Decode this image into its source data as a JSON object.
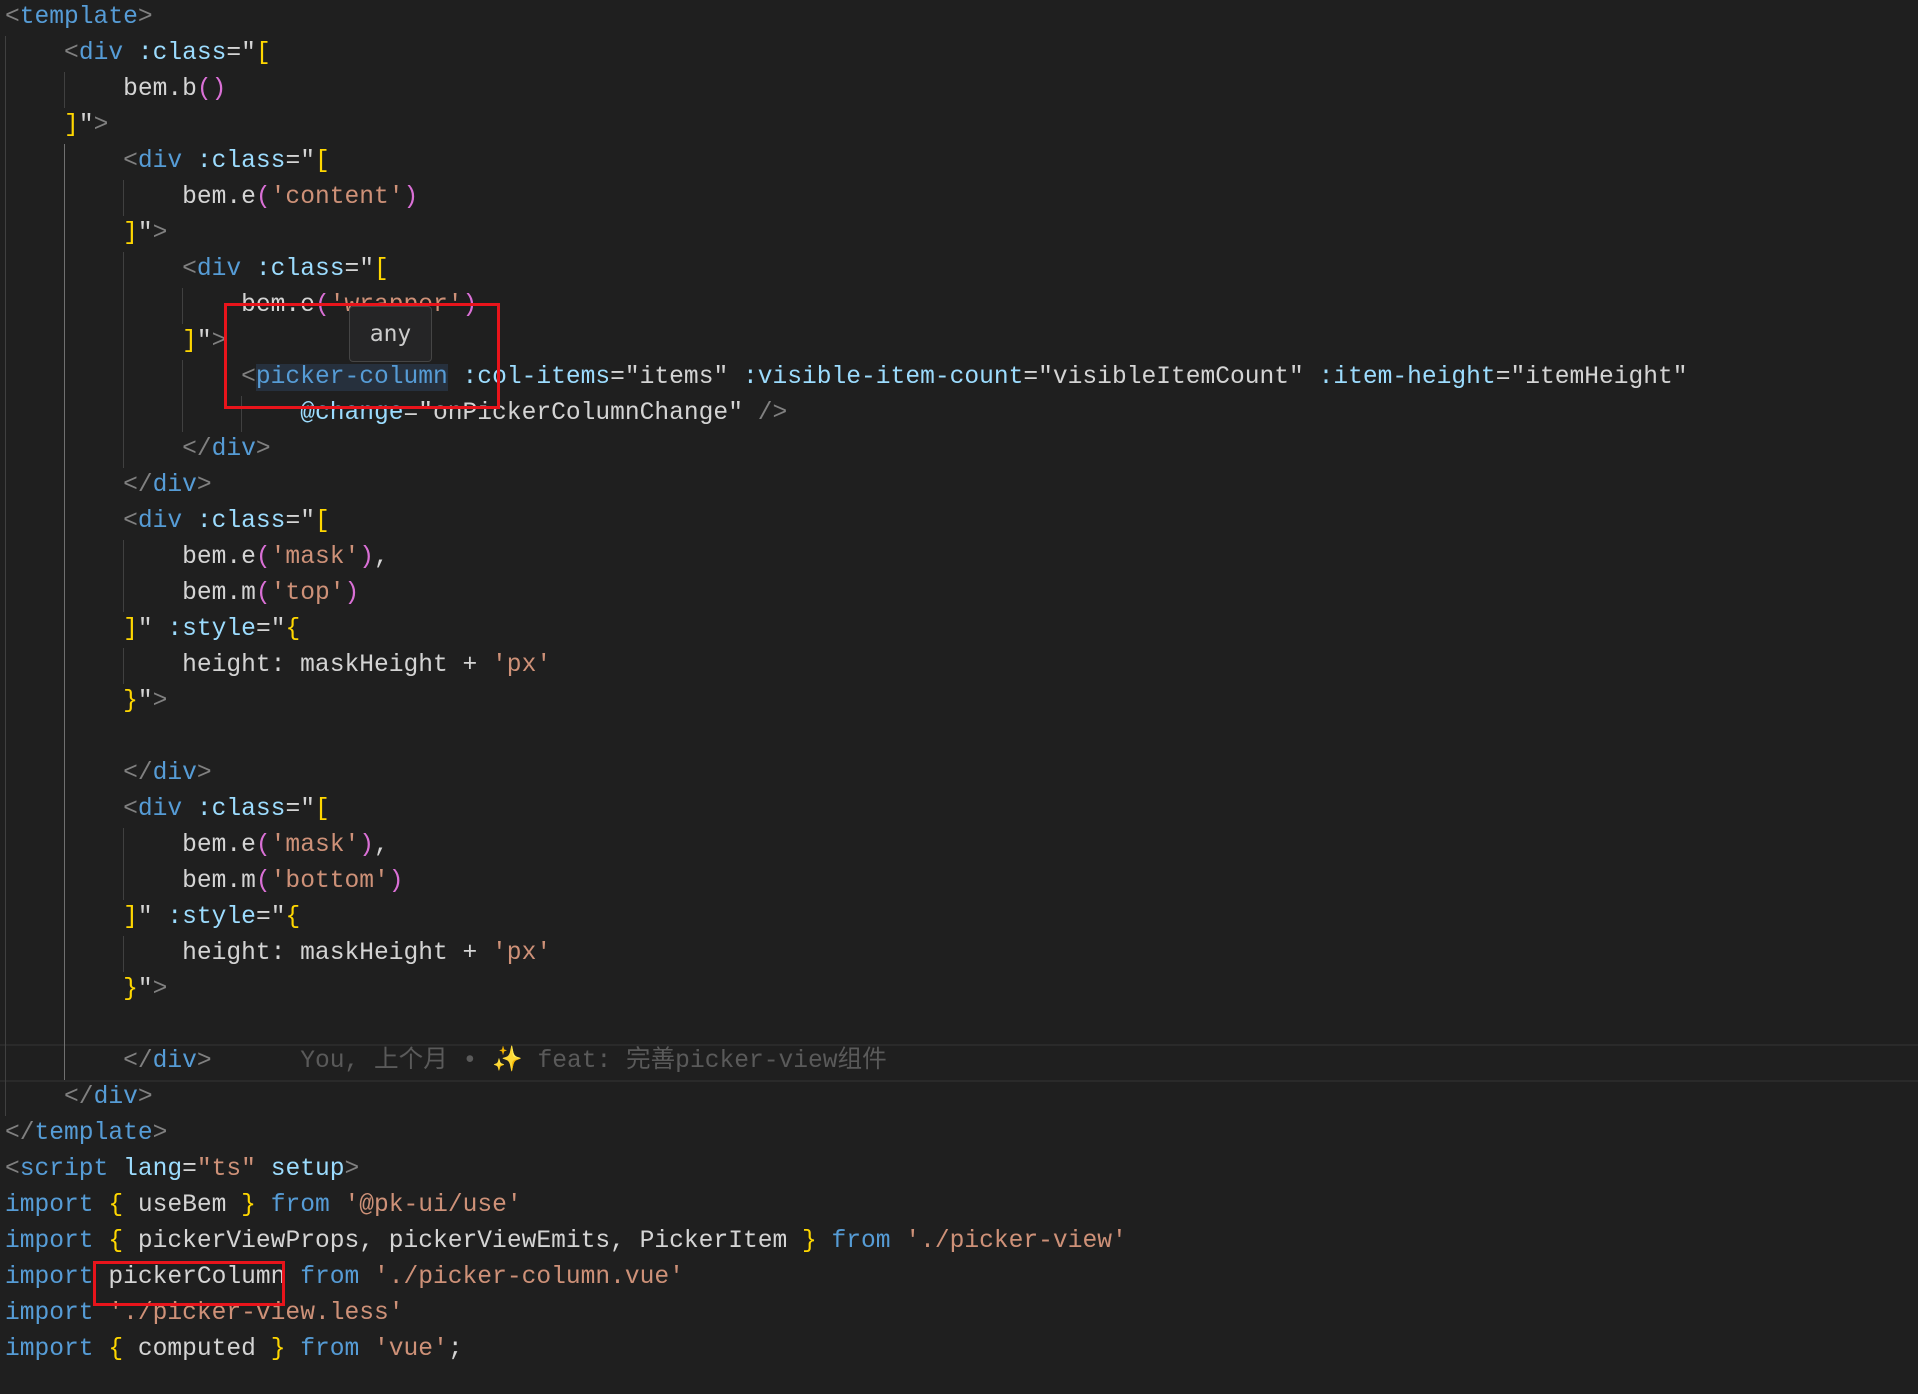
{
  "editor": {
    "language": "vue",
    "lines": [
      [
        [
          "p",
          "<"
        ],
        [
          "t",
          "template"
        ],
        [
          "p",
          ">"
        ]
      ],
      [
        [
          "w",
          "    "
        ],
        [
          "p",
          "<"
        ],
        [
          "t",
          "div"
        ],
        [
          "w",
          " "
        ],
        [
          "a",
          ":class"
        ],
        [
          "w",
          "=\""
        ],
        [
          "y",
          "["
        ]
      ],
      [
        [
          "w",
          "        bem.b"
        ],
        [
          "m",
          "()"
        ]
      ],
      [
        [
          "w",
          "    "
        ],
        [
          "y",
          "]"
        ],
        [
          "w",
          "\""
        ],
        [
          "p",
          ">"
        ]
      ],
      [
        [
          "w",
          "        "
        ],
        [
          "p",
          "<"
        ],
        [
          "t",
          "div"
        ],
        [
          "w",
          " "
        ],
        [
          "a",
          ":class"
        ],
        [
          "w",
          "=\""
        ],
        [
          "y",
          "["
        ]
      ],
      [
        [
          "w",
          "            bem.e"
        ],
        [
          "m",
          "("
        ],
        [
          "s",
          "'content'"
        ],
        [
          "m",
          ")"
        ]
      ],
      [
        [
          "w",
          "        "
        ],
        [
          "y",
          "]"
        ],
        [
          "w",
          "\""
        ],
        [
          "p",
          ">"
        ]
      ],
      [
        [
          "w",
          "            "
        ],
        [
          "p",
          "<"
        ],
        [
          "t",
          "div"
        ],
        [
          "w",
          " "
        ],
        [
          "a",
          ":class"
        ],
        [
          "w",
          "=\""
        ],
        [
          "y",
          "["
        ]
      ],
      [
        [
          "w",
          "                bem.e"
        ],
        [
          "m",
          "("
        ],
        [
          "s",
          "'wrapper'"
        ],
        [
          "m",
          ")"
        ]
      ],
      [
        [
          "w",
          "            "
        ],
        [
          "y",
          "]"
        ],
        [
          "w",
          "\""
        ],
        [
          "p",
          ">"
        ]
      ],
      [
        [
          "w",
          "                "
        ],
        [
          "p",
          "<"
        ],
        [
          "t sel",
          "picker-column"
        ],
        [
          "w",
          " "
        ],
        [
          "a",
          ":col-items"
        ],
        [
          "w",
          "=\"items\" "
        ],
        [
          "a",
          ":visible-item-count"
        ],
        [
          "w",
          "=\"visibleItemCount\" "
        ],
        [
          "a",
          ":item-height"
        ],
        [
          "w",
          "=\"itemHeight\""
        ]
      ],
      [
        [
          "w",
          "                    "
        ],
        [
          "a",
          "@change"
        ],
        [
          "w",
          "=\"onPickerColumnChange\" "
        ],
        [
          "p",
          "/>"
        ]
      ],
      [
        [
          "w",
          "            "
        ],
        [
          "p",
          "</"
        ],
        [
          "t",
          "div"
        ],
        [
          "p",
          ">"
        ]
      ],
      [
        [
          "w",
          "        "
        ],
        [
          "p",
          "</"
        ],
        [
          "t",
          "div"
        ],
        [
          "p",
          ">"
        ]
      ],
      [
        [
          "w",
          "        "
        ],
        [
          "p",
          "<"
        ],
        [
          "t",
          "div"
        ],
        [
          "w",
          " "
        ],
        [
          "a",
          ":class"
        ],
        [
          "w",
          "=\""
        ],
        [
          "y",
          "["
        ]
      ],
      [
        [
          "w",
          "            bem.e"
        ],
        [
          "m",
          "("
        ],
        [
          "s",
          "'mask'"
        ],
        [
          "m",
          ")"
        ],
        [
          "w",
          ","
        ]
      ],
      [
        [
          "w",
          "            bem.m"
        ],
        [
          "m",
          "("
        ],
        [
          "s",
          "'top'"
        ],
        [
          "m",
          ")"
        ]
      ],
      [
        [
          "w",
          "        "
        ],
        [
          "y",
          "]"
        ],
        [
          "w",
          "\" "
        ],
        [
          "a",
          ":style"
        ],
        [
          "w",
          "=\""
        ],
        [
          "y",
          "{"
        ]
      ],
      [
        [
          "w",
          "            height: maskHeight + "
        ],
        [
          "s",
          "'px'"
        ]
      ],
      [
        [
          "w",
          "        "
        ],
        [
          "y",
          "}"
        ],
        [
          "w",
          "\""
        ],
        [
          "p",
          ">"
        ]
      ],
      [],
      [
        [
          "w",
          "        "
        ],
        [
          "p",
          "</"
        ],
        [
          "t",
          "div"
        ],
        [
          "p",
          ">"
        ]
      ],
      [
        [
          "w",
          "        "
        ],
        [
          "p",
          "<"
        ],
        [
          "t",
          "div"
        ],
        [
          "w",
          " "
        ],
        [
          "a",
          ":class"
        ],
        [
          "w",
          "=\""
        ],
        [
          "y",
          "["
        ]
      ],
      [
        [
          "w",
          "            bem.e"
        ],
        [
          "m",
          "("
        ],
        [
          "s",
          "'mask'"
        ],
        [
          "m",
          ")"
        ],
        [
          "w",
          ","
        ]
      ],
      [
        [
          "w",
          "            bem.m"
        ],
        [
          "m",
          "("
        ],
        [
          "s",
          "'bottom'"
        ],
        [
          "m",
          ")"
        ]
      ],
      [
        [
          "w",
          "        "
        ],
        [
          "y",
          "]"
        ],
        [
          "w",
          "\" "
        ],
        [
          "a",
          ":style"
        ],
        [
          "w",
          "=\""
        ],
        [
          "y",
          "{"
        ]
      ],
      [
        [
          "w",
          "            height: maskHeight + "
        ],
        [
          "s",
          "'px'"
        ]
      ],
      [
        [
          "w",
          "        "
        ],
        [
          "y",
          "}"
        ],
        [
          "w",
          "\""
        ],
        [
          "p",
          ">"
        ]
      ],
      [],
      [
        [
          "w",
          "        "
        ],
        [
          "p",
          "</"
        ],
        [
          "t",
          "div"
        ],
        [
          "p",
          ">"
        ],
        [
          "b",
          "      You, 上个月 • ✨ feat: 完善picker-view组件"
        ]
      ],
      [
        [
          "w",
          "    "
        ],
        [
          "p",
          "</"
        ],
        [
          "t",
          "div"
        ],
        [
          "p",
          ">"
        ]
      ],
      [
        [
          "p",
          "</"
        ],
        [
          "t",
          "template"
        ],
        [
          "p",
          ">"
        ]
      ],
      [
        [
          "p",
          "<"
        ],
        [
          "t",
          "script"
        ],
        [
          "w",
          " "
        ],
        [
          "a",
          "lang"
        ],
        [
          "w",
          "="
        ],
        [
          "s",
          "\"ts\""
        ],
        [
          "w",
          " "
        ],
        [
          "a",
          "setup"
        ],
        [
          "p",
          ">"
        ]
      ],
      [
        [
          "k",
          "import"
        ],
        [
          "w",
          " "
        ],
        [
          "y",
          "{"
        ],
        [
          "w",
          " useBem "
        ],
        [
          "y",
          "}"
        ],
        [
          "w",
          " "
        ],
        [
          "k",
          "from"
        ],
        [
          "w",
          " "
        ],
        [
          "s",
          "'@pk-ui/use'"
        ]
      ],
      [
        [
          "k",
          "import"
        ],
        [
          "w",
          " "
        ],
        [
          "y",
          "{"
        ],
        [
          "w",
          " pickerViewProps, pickerViewEmits, PickerItem "
        ],
        [
          "y",
          "}"
        ],
        [
          "w",
          " "
        ],
        [
          "k",
          "from"
        ],
        [
          "w",
          " "
        ],
        [
          "s",
          "'./picker-view'"
        ]
      ],
      [
        [
          "k",
          "import"
        ],
        [
          "w",
          " pickerColumn "
        ],
        [
          "k",
          "from"
        ],
        [
          "w",
          " "
        ],
        [
          "s",
          "'./picker-column.vue'"
        ]
      ],
      [
        [
          "k",
          "import"
        ],
        [
          "w",
          " "
        ],
        [
          "s",
          "'./picker-view.less'"
        ]
      ],
      [
        [
          "k",
          "import"
        ],
        [
          "w",
          " "
        ],
        [
          "y",
          "{"
        ],
        [
          "w",
          " computed "
        ],
        [
          "y",
          "}"
        ],
        [
          "w",
          " "
        ],
        [
          "k",
          "from"
        ],
        [
          "w",
          " "
        ],
        [
          "s",
          "'vue'"
        ],
        [
          "w",
          ";"
        ]
      ]
    ]
  },
  "hover_tooltip": {
    "text": "any"
  },
  "blame": {
    "author": "You",
    "when": "上个月",
    "message": "feat: 完善picker-view组件"
  },
  "annotations": {
    "highlight_color": "#e8141b"
  }
}
